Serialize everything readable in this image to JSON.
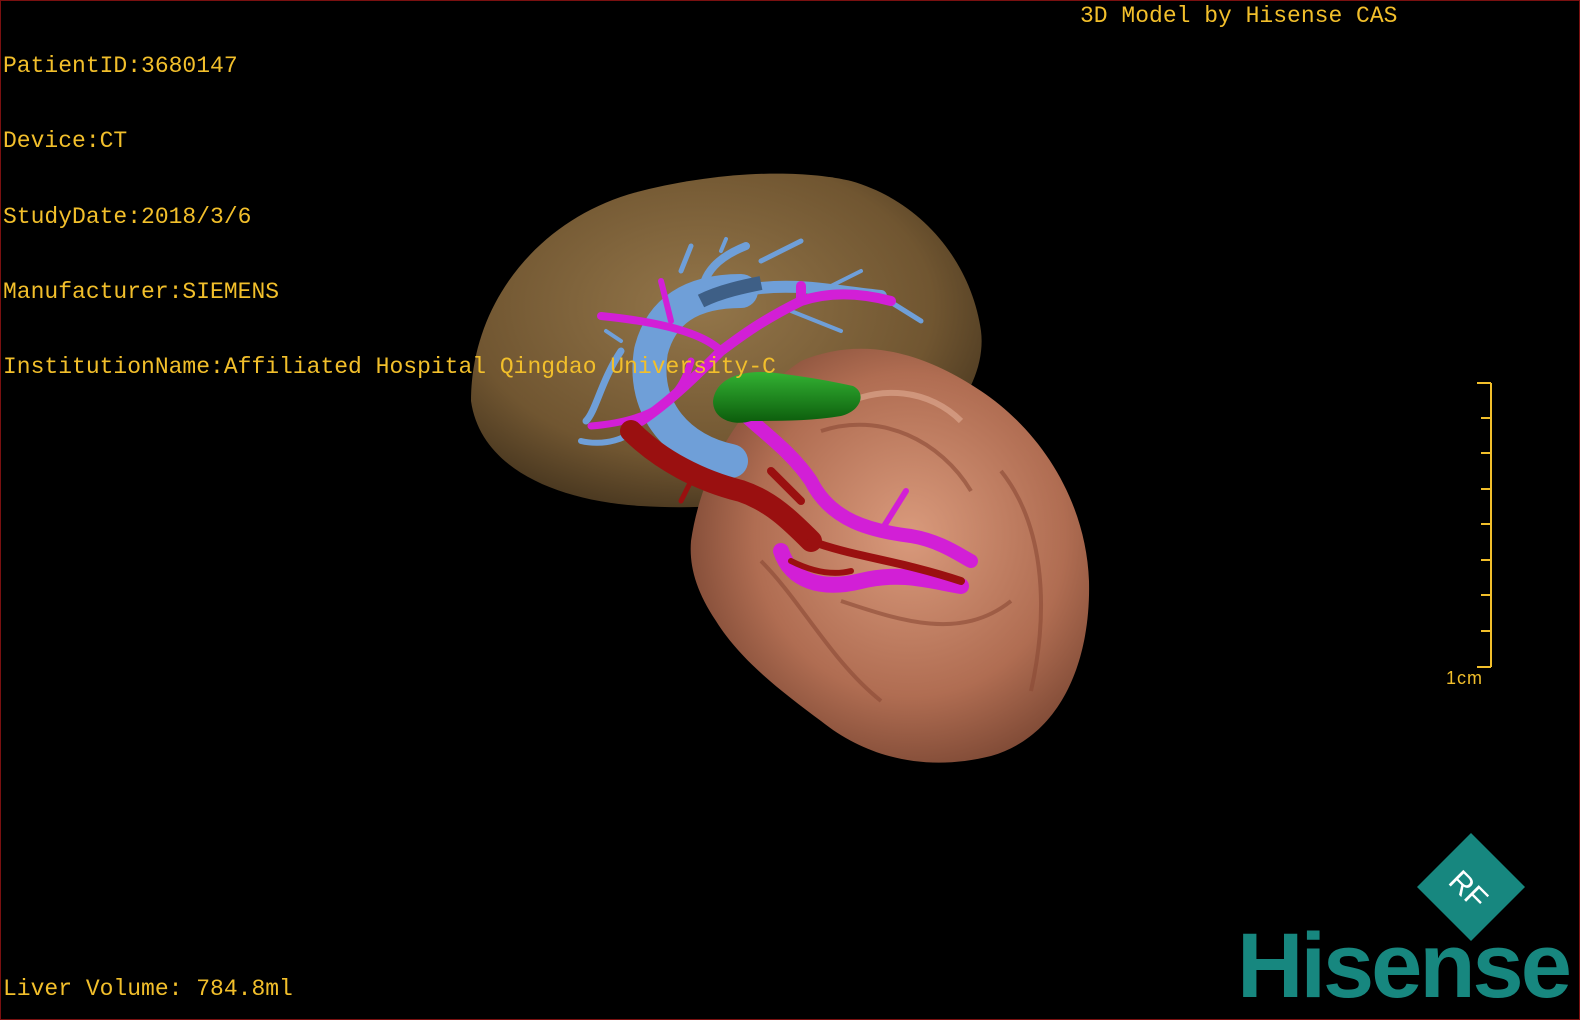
{
  "patient_info": {
    "patient_id": "PatientID:3680147",
    "device": "Device:CT",
    "study_date": "StudyDate:2018/3/6",
    "manufacturer": "Manufacturer:SIEMENS",
    "institution": "InstitutionName:Affiliated Hospital Qingdao University-C"
  },
  "watermark_text": "3D Model by Hisense CAS",
  "liver_volume": "Liver Volume: 784.8ml",
  "scale": {
    "label": "1cm"
  },
  "logo": {
    "badge_text": "RF",
    "brand": "Hisense"
  },
  "colors": {
    "overlay_text": "#f2bf2b",
    "liver": "#8a6a3c",
    "stomach": "#c07a5c",
    "hepatic_vein": "#6f9fd8",
    "portal_vein": "#d21fd6",
    "artery": "#9a1010",
    "gallbladder": "#1c8c1c",
    "logo": "#17877f"
  }
}
